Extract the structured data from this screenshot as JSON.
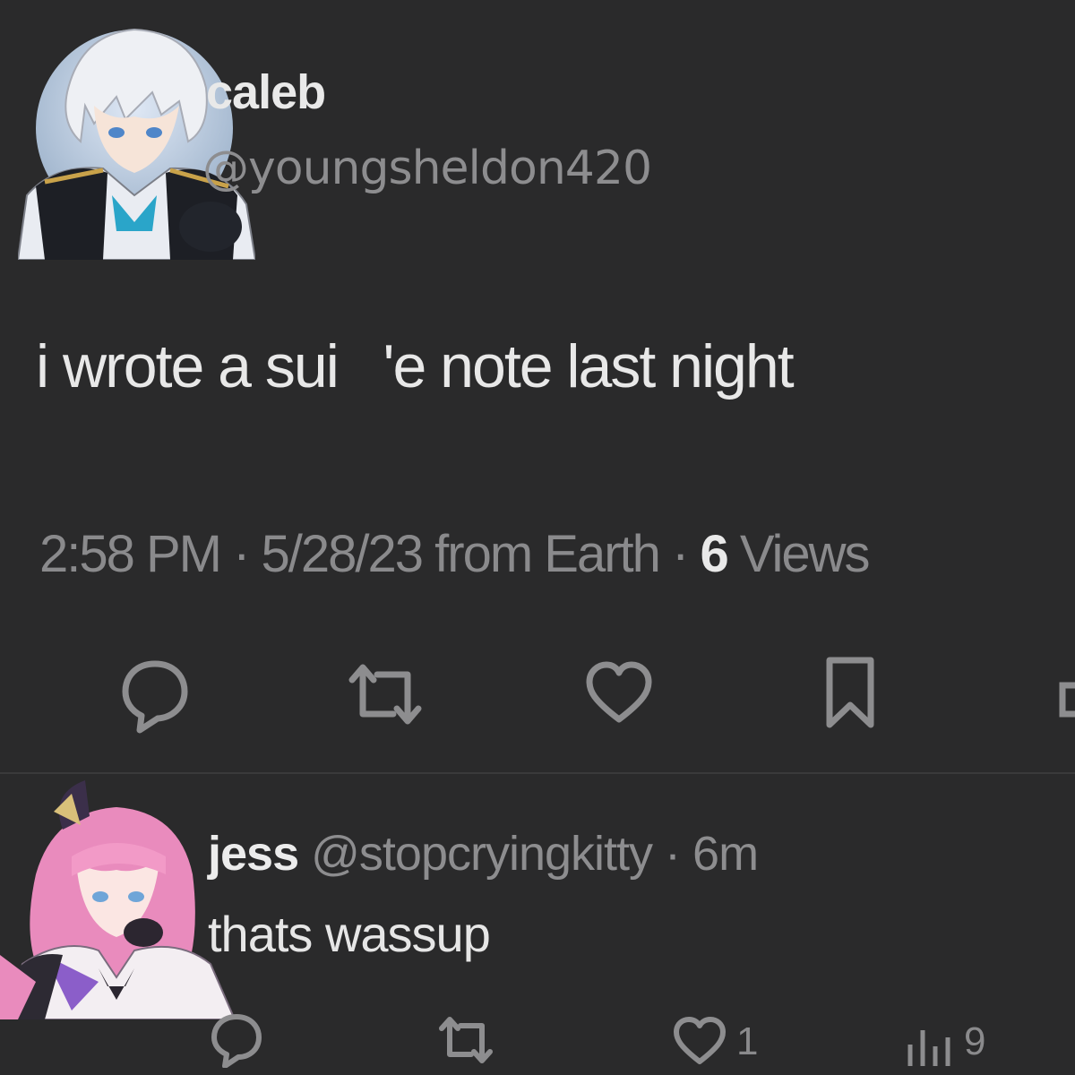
{
  "tweet": {
    "author_name": "caleb",
    "author_handle": "@youngsheldon420",
    "text": "i wrote a sui   'e note last night",
    "time": "2:58 PM · 5/28/23 from Earth · ",
    "views_count": "6",
    "views_label": " Views",
    "avatar_icon": "anime-avatar-white-hair",
    "actions": [
      "reply-icon",
      "retweet-icon",
      "like-icon",
      "bookmark-icon",
      "share-icon"
    ]
  },
  "reply": {
    "author_name": "jess",
    "author_handle": " @stopcryingkitty · 6m",
    "text": "thats wassup",
    "avatar_icon": "anime-avatar-pink-hair",
    "like_count": "1",
    "views_count": "9",
    "actions": [
      "reply-icon",
      "retweet-icon",
      "like-icon",
      "views-icon"
    ]
  },
  "colors": {
    "background": "#2a2a2b",
    "text": "#e8e8e8",
    "muted": "#8a8a8c",
    "divider": "#3a3a3b"
  }
}
